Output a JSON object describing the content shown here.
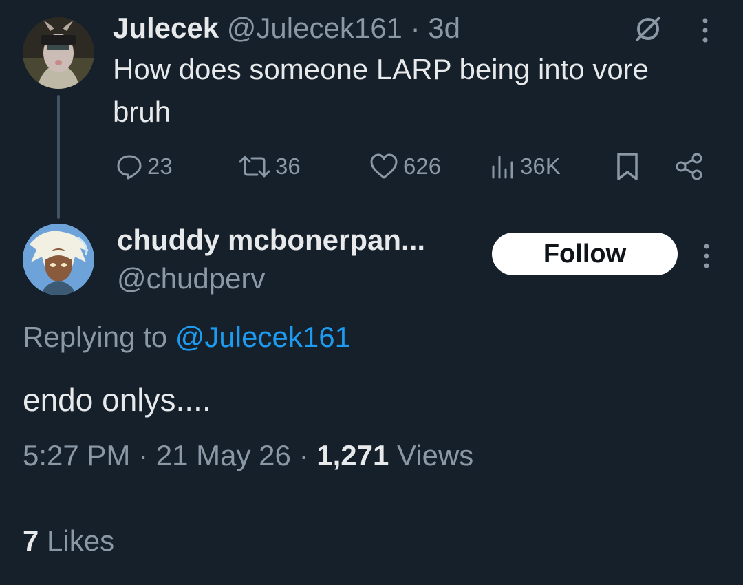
{
  "parent_tweet": {
    "author_name": "Julecek",
    "author_handle": "@Julecek161",
    "separator": "·",
    "time_ago": "3d",
    "text": "How does someone LARP being into vore bruh",
    "actions": {
      "replies": "23",
      "retweets": "36",
      "likes": "626",
      "views": "36K"
    }
  },
  "reply": {
    "author_name": "chuddy mcbonerpan...",
    "author_handle": "@chudperv",
    "follow_label": "Follow",
    "replying_prefix": "Replying to ",
    "replying_to": "@Julecek161",
    "text": "endo onlys....",
    "time": "5:27 PM",
    "date": "21 May 26",
    "separator": "·",
    "views_count": "1,271",
    "views_label": " Views",
    "likes_count": "7",
    "likes_label": " Likes"
  },
  "colors": {
    "background": "#15202b",
    "text_primary": "#e7e9ea",
    "text_muted": "#8b98a5",
    "link": "#1d9bf0",
    "follow_bg": "#ffffff"
  }
}
